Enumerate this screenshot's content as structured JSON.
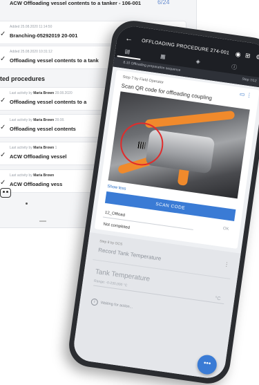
{
  "background_list": {
    "top_item": "ACW Offloading vessel contents to a tanker - 106-001",
    "top_count": "6/24",
    "items_top": [
      {
        "meta": "Added 25.08.2020 11:14:50",
        "name": "Branching-05292019 20-001"
      },
      {
        "meta": "Added 25.08.2020 10:31:12",
        "name": "Offloading vessel contents to a tank"
      }
    ],
    "section_heading": "ted procedures",
    "items_completed": [
      {
        "meta_label": "Last activity by",
        "meta_user": "Maria Brown",
        "meta_date": "28.08.2020",
        "name": "Offloading vessel contents to a"
      },
      {
        "meta_label": "Last activity by",
        "meta_user": "Maria Brown",
        "meta_date": "28.08.",
        "name": "Offloading vessel contents"
      },
      {
        "meta_label": "Last activity by",
        "meta_user": "Maria Brown",
        "meta_date": "1",
        "name": "ACW Offloading vessel"
      },
      {
        "meta_label": "Last activity by",
        "meta_user": "Maria Brown",
        "meta_date": "",
        "name": "ACW Offloading vess"
      }
    ]
  },
  "phone": {
    "appbar": {
      "back_icon": "←",
      "title": "OFFLOADING PROCEDURE 274-001",
      "icons": [
        "◉",
        "⊞",
        "⚙"
      ]
    },
    "tabs": [
      "▤",
      "▦",
      "◈",
      "ⓘ"
    ],
    "subbar": {
      "sequence": "8.10 Offloading preparation sequence",
      "step": "Step 7/12"
    },
    "current_step": {
      "who": "Step 7 by Field Operator",
      "heading": "Scan QR code for offloading coupling",
      "show_less": "Show less",
      "scan_button": "SCAN CODE",
      "code_value": "12_Offload",
      "ok_label": "OK",
      "status": "Not completed"
    },
    "next_step": {
      "step": "Step 8 by OCS",
      "name": "Record Tank Temperature",
      "field_label": "Tank Temperature",
      "range": "Range: -0-230,000 °C",
      "unit": "°C",
      "waiting": "Waiting for action..."
    },
    "fab_label": "•••"
  }
}
